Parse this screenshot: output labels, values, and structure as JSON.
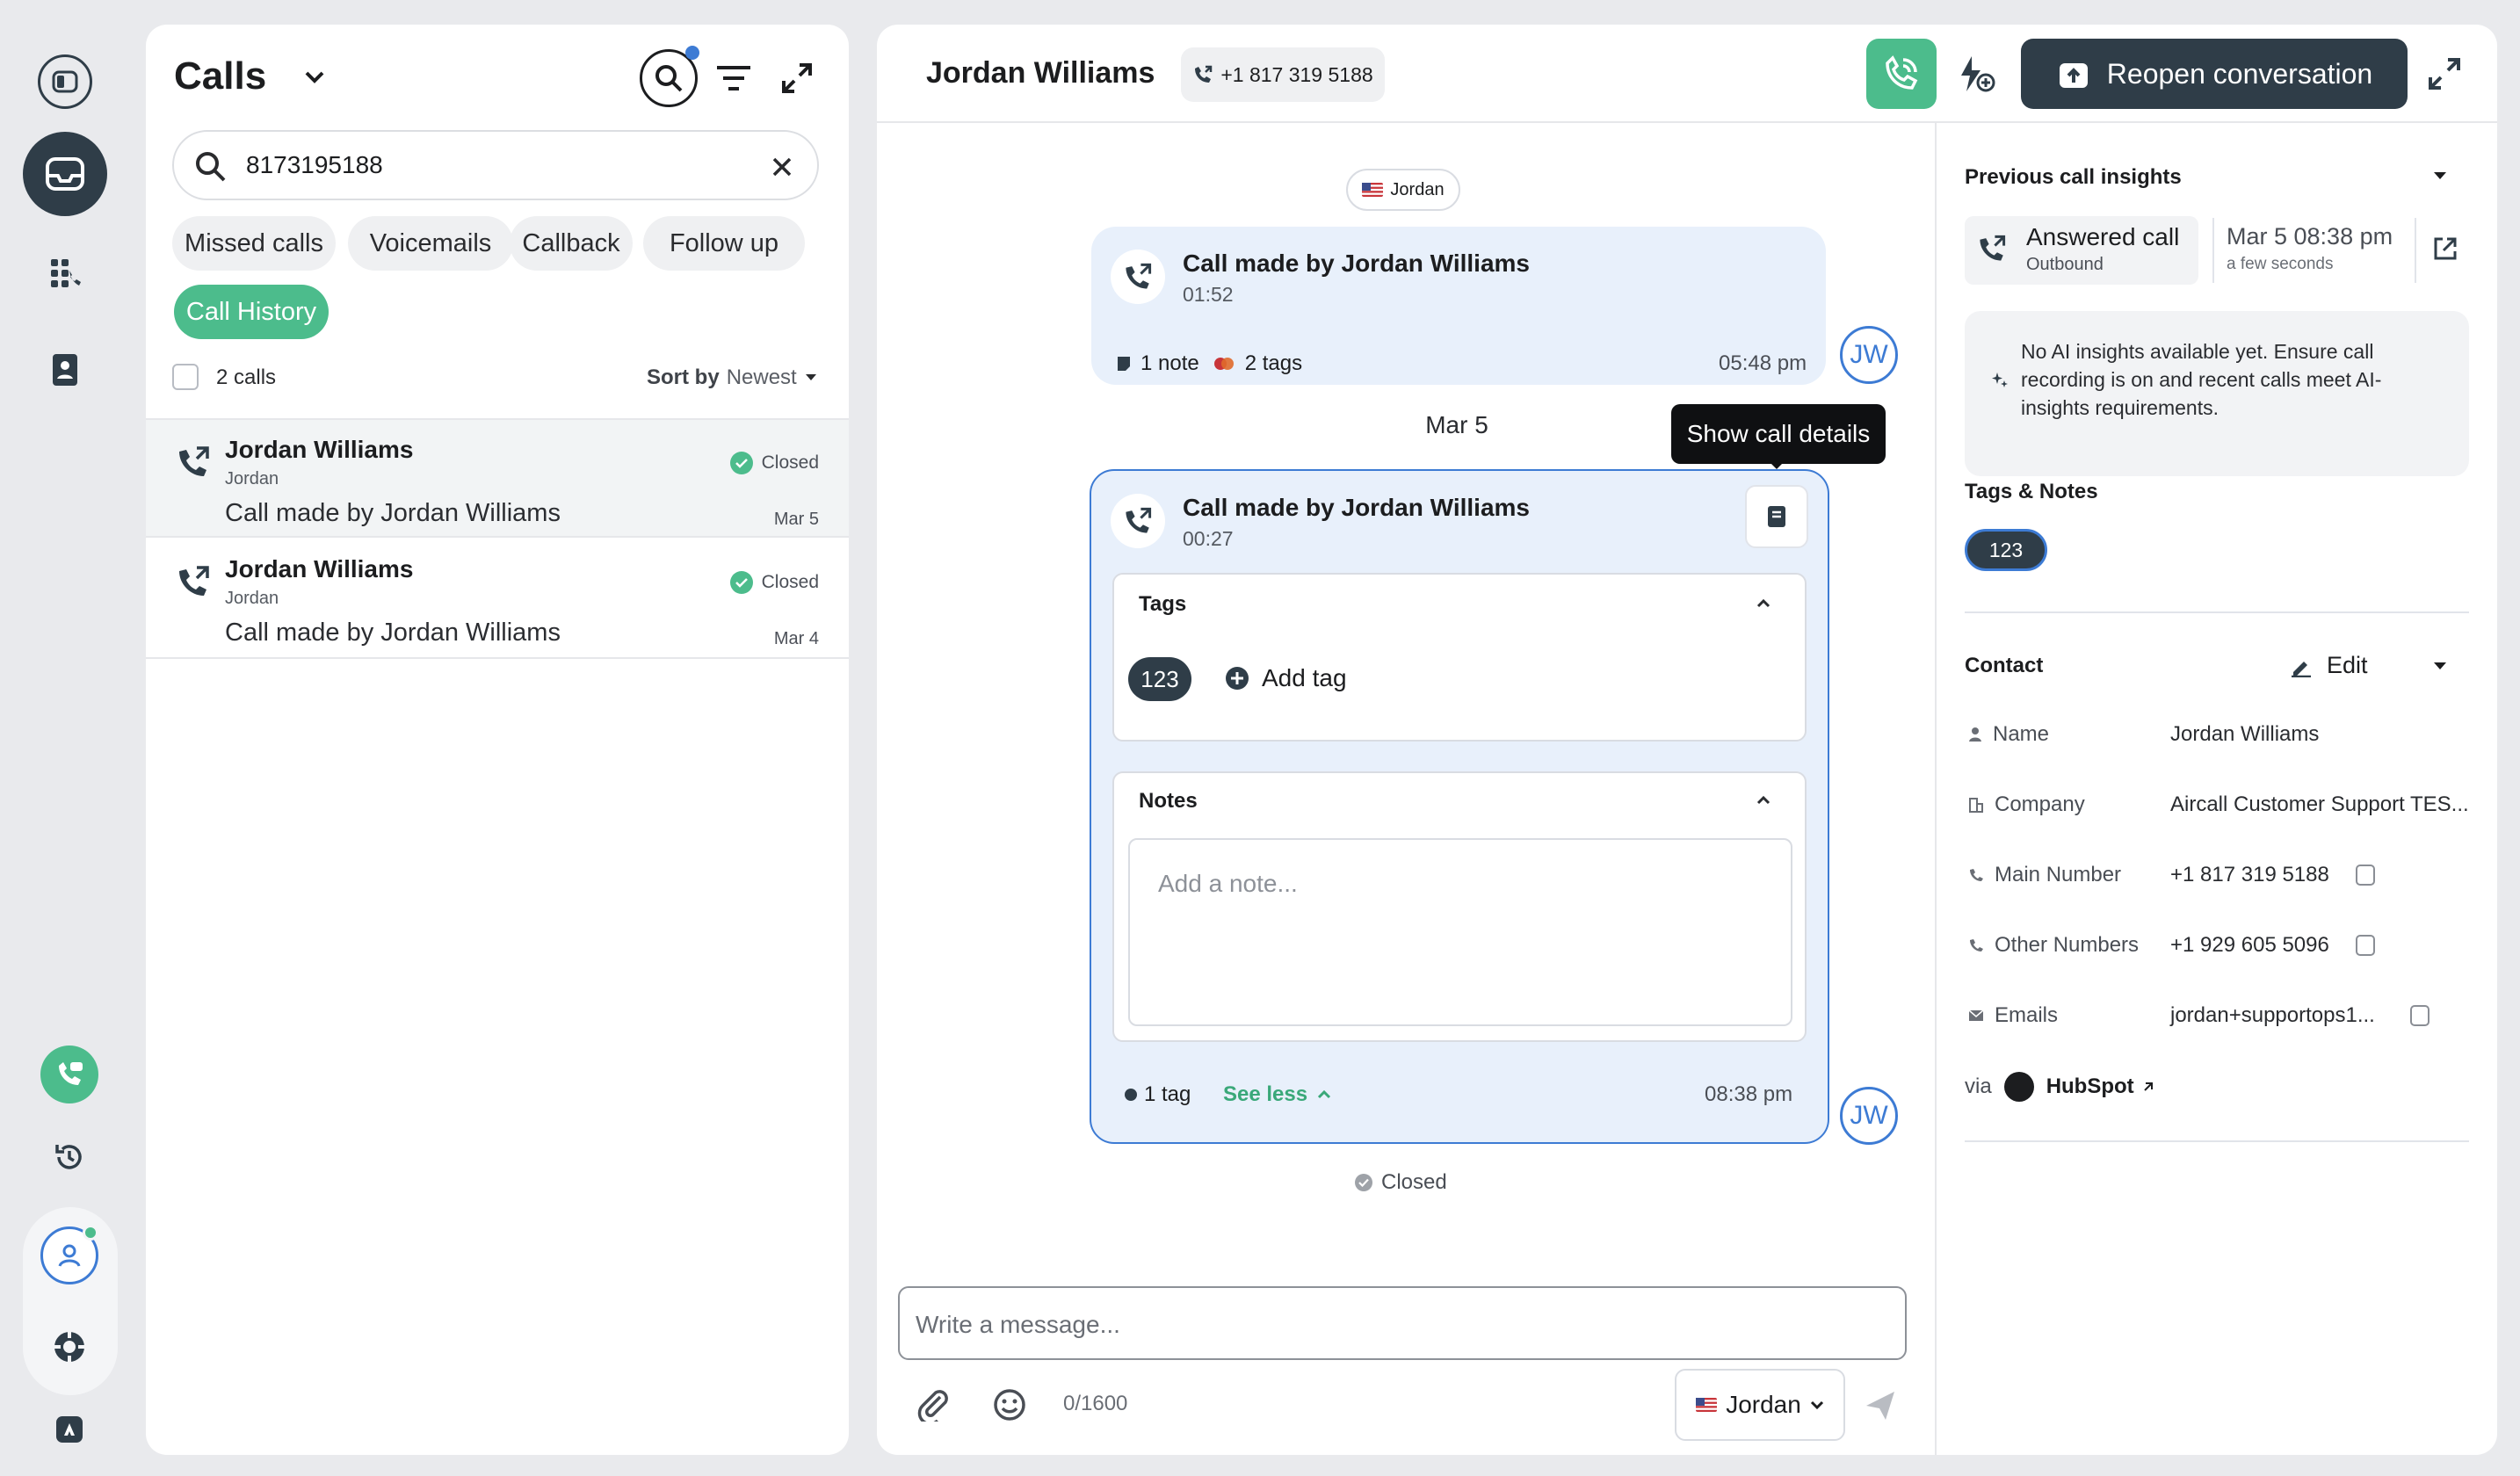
{
  "calls_panel": {
    "title": "Calls",
    "search_value": "8173195188",
    "filters": [
      {
        "label": "Missed calls",
        "active": false
      },
      {
        "label": "Voicemails",
        "active": false
      },
      {
        "label": "Callback",
        "active": false
      },
      {
        "label": "Follow up",
        "active": false
      },
      {
        "label": "Call History",
        "active": true
      }
    ],
    "count_label": "2 calls",
    "sort_prefix": "Sort by",
    "sort_value": "Newest",
    "calls": [
      {
        "name": "Jordan Williams",
        "sub": "Jordan",
        "description": "Call made by Jordan Williams",
        "status": "Closed",
        "date": "Mar 5",
        "selected": true
      },
      {
        "name": "Jordan Williams",
        "sub": "Jordan",
        "description": "Call made by Jordan Williams",
        "status": "Closed",
        "date": "Mar 4",
        "selected": false
      }
    ]
  },
  "header": {
    "contact_name": "Jordan Williams",
    "phone": "+1 817 319 5188",
    "reopen_label": "Reopen conversation"
  },
  "conversation": {
    "line_tag": "Jordan",
    "call1": {
      "title": "Call made by Jordan Williams",
      "duration": "01:52",
      "notes": "1 note",
      "tags": "2 tags",
      "time": "05:48 pm",
      "avatar": "JW"
    },
    "date_divider": "Mar 5",
    "tooltip": "Show call details",
    "call2": {
      "title": "Call made by Jordan Williams",
      "duration": "00:27",
      "tags_label": "Tags",
      "tag_value": "123",
      "add_tag_label": "Add tag",
      "notes_label": "Notes",
      "note_placeholder": "Add a note...",
      "tag_count": "1 tag",
      "see_less": "See less",
      "time": "08:38 pm",
      "avatar": "JW"
    },
    "closed_label": "Closed"
  },
  "composer": {
    "placeholder": "Write a message...",
    "char_count": "0/1600",
    "sender": "Jordan"
  },
  "sidebar": {
    "previous_insights_label": "Previous call insights",
    "answered_label": "Answered call",
    "direction": "Outbound",
    "insight_date": "Mar 5 08:38 pm",
    "insight_relative": "a few seconds",
    "ai_message": "No AI insights available yet. Ensure call recording is on and recent calls meet AI-insights requirements.",
    "tags_notes_label": "Tags & Notes",
    "tag": "123",
    "contact_label": "Contact",
    "edit_label": "Edit",
    "contact": {
      "name_key": "Name",
      "name_value": "Jordan Williams",
      "company_key": "Company",
      "company_value": "Aircall Customer Support TES...",
      "main_key": "Main Number",
      "main_value": "+1 817 319 5188",
      "other_key": "Other Numbers",
      "other_value": "+1 929 605 5096",
      "emails_key": "Emails",
      "emails_value": "jordan+supportops1...",
      "via_label": "via",
      "via_value": "HubSpot"
    }
  },
  "colors": {
    "accent_green": "#4cbc8c",
    "dark_slate": "#2f3d48",
    "avatar_blue": "#3d7bd4",
    "bubble_bg": "#e8f0fb"
  }
}
